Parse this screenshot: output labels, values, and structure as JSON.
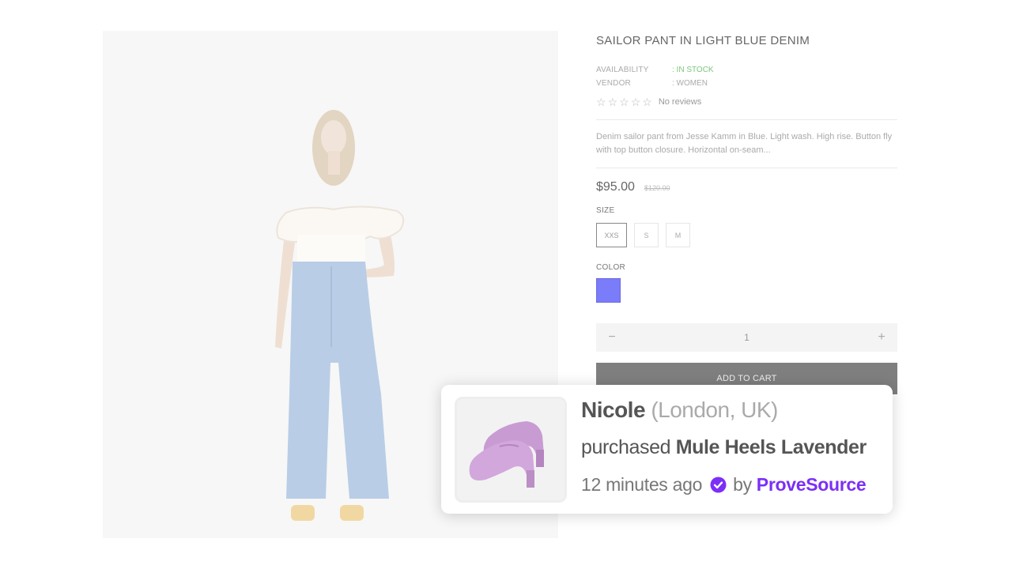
{
  "product": {
    "title": "SAILOR PANT IN LIGHT BLUE DENIM",
    "availability_label": "AVAILABILITY",
    "availability_value": ": IN STOCK",
    "vendor_label": "VENDOR",
    "vendor_value": ": WOMEN",
    "reviews_text": "No reviews",
    "rating_stars": 5,
    "rating_value": 0,
    "description": "Denim sailor pant from Jesse Kamm in Blue. Light wash. High rise. Button fly with top button closure. Horizontal on-seam...",
    "price": "$95.00",
    "old_price": "$120.00",
    "size_label": "SIZE",
    "sizes": [
      "XXS",
      "S",
      "M"
    ],
    "selected_size": "XXS",
    "color_label": "COLOR",
    "color_swatch": "#7b7cf9",
    "quantity": "1",
    "qty_minus": "−",
    "qty_plus": "+",
    "add_to_cart": "ADD TO CART"
  },
  "notification": {
    "name": "Nicole",
    "location": "(London, UK)",
    "action": "purchased",
    "product": "Mule Heels Lavender",
    "time": "12 minutes ago",
    "by": "by",
    "brand": "ProveSource",
    "brand_color": "#7b2ff7",
    "verified_icon": "check-circle-icon",
    "thumb_color": "#c99bd3"
  }
}
